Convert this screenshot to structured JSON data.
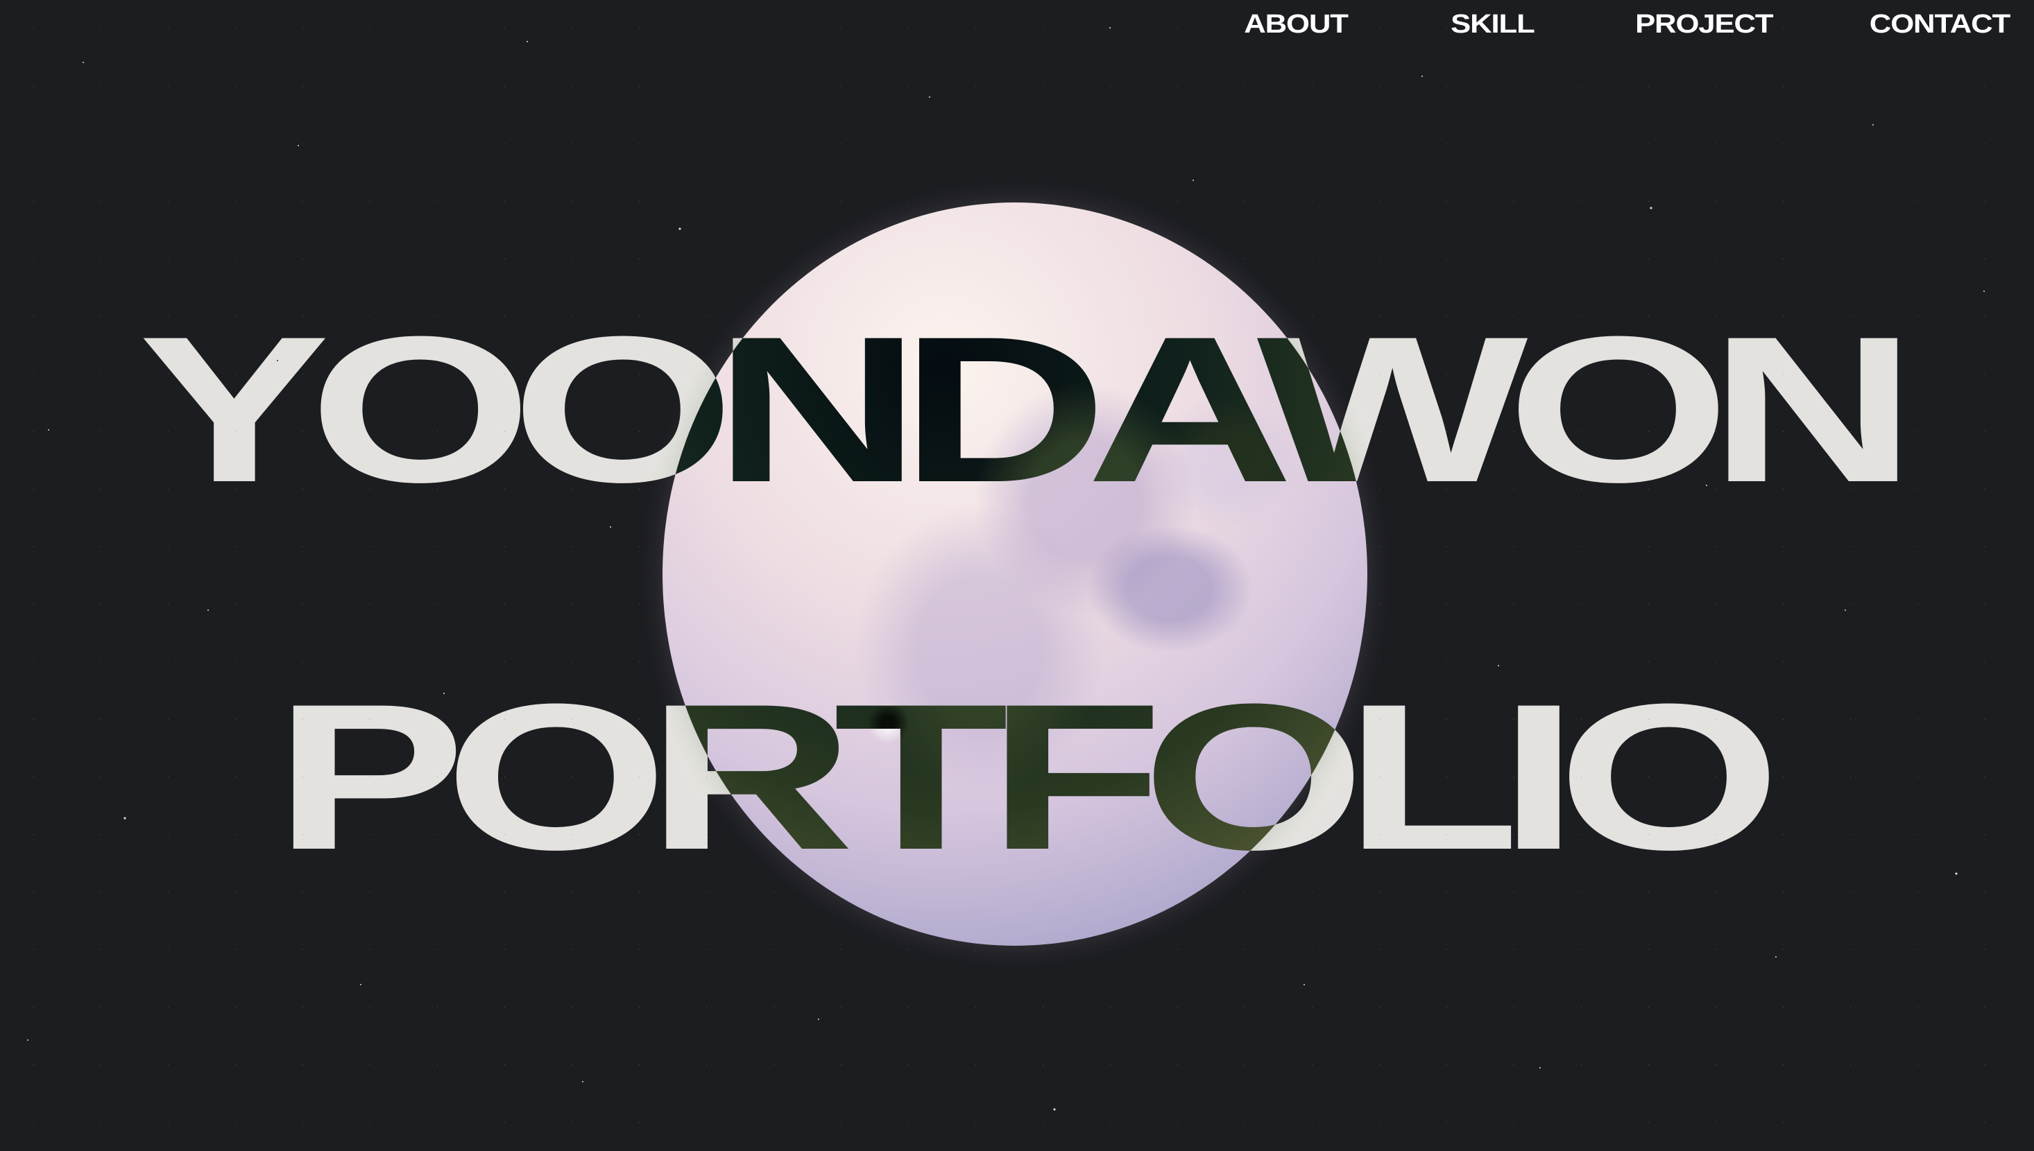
{
  "nav": {
    "items": [
      {
        "label": "ABOUT"
      },
      {
        "label": "SKILL"
      },
      {
        "label": "PROJECT"
      },
      {
        "label": "CONTACT"
      }
    ]
  },
  "hero": {
    "title_line1": "YOONDAWON",
    "title_line2": "PORTFOLIO"
  },
  "colors": {
    "background": "#1c1d21",
    "text": "#ffffff",
    "moon": "#eedde2"
  }
}
